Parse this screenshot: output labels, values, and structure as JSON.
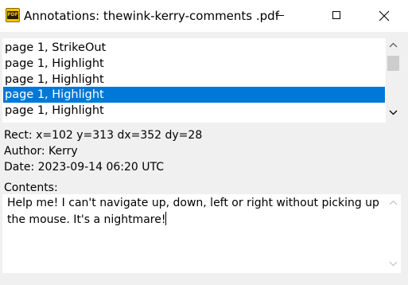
{
  "window": {
    "title": "Annotations: thewink-kerry-comments .pdf",
    "app_icon_text": "PDF"
  },
  "annotations": {
    "items": [
      {
        "label": "page 1, StrikeOut",
        "selected": false
      },
      {
        "label": "page 1, Highlight",
        "selected": false
      },
      {
        "label": "page 1, Highlight",
        "selected": false
      },
      {
        "label": "page 1, Highlight",
        "selected": true
      },
      {
        "label": "page 1, Highlight",
        "selected": false
      }
    ],
    "selection_color": "#0078d7"
  },
  "details": {
    "rect": "Rect: x=102 y=313 dx=352 dy=28",
    "author": "Author: Kerry",
    "date": "Date: 2023-09-14 06:20 UTC",
    "contents_label": "Contents:",
    "contents_text": "Help me! I can't navigate up, down, left or right without picking up the mouse. It's a nightmare!"
  }
}
